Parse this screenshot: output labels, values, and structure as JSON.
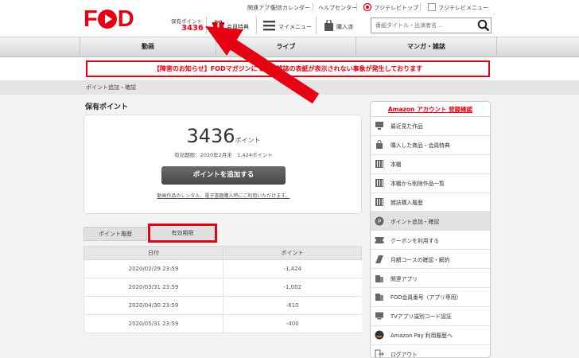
{
  "header": {
    "logo": "FOD",
    "top_links": [
      "関連アプリ",
      "配信カレンダー",
      "ヘルプセンター",
      "フジテレビトップ",
      "フジテレビメニュー"
    ],
    "points_label": "保有ポイント",
    "points_value": "3436",
    "member_benefits": "会員特典",
    "my_menu": "マイメニュー",
    "purchased": "購入済",
    "search_placeholder": "番組タイトル・出演者名..."
  },
  "nav": {
    "tabs": [
      "動画",
      "ライブ",
      "マンガ・雑誌"
    ]
  },
  "notice": "【障害のお知らせ】FODマガジンにて一部雑誌の表紙が表示されない事象が発生しております",
  "breadcrumb": "ポイント追加・確認",
  "points_section": {
    "title": "保有ポイント",
    "value": "3436",
    "unit": "ポイント",
    "expiry": "有効期限：2020年2月末　1,424ポイント",
    "add_button": "ポイントを追加する",
    "note": "動画作品のレンタル、電子書籍購入時にご利用いただけます。"
  },
  "tabs": {
    "history": "ポイント履歴",
    "expiry": "有効期限"
  },
  "table": {
    "headers": [
      "日付",
      "ポイント"
    ],
    "rows": [
      [
        "2020/02/29 23:59",
        "-1,424"
      ],
      [
        "2020/03/31 23:59",
        "-1,002"
      ],
      [
        "2020/04/30 23:59",
        "-610"
      ],
      [
        "2020/05/31 23:59",
        "-400"
      ]
    ]
  },
  "sidebar": {
    "header": "Amazon アカウント 登録確認",
    "items": [
      {
        "label": "最近見た作品",
        "icon": "monitor-icon"
      },
      {
        "label": "購入した商品・会員特典",
        "icon": "shopping-bag-icon"
      },
      {
        "label": "本棚",
        "icon": "bookshelf-icon"
      },
      {
        "label": "本棚から削除作品一覧",
        "icon": "bookshelf-icon"
      },
      {
        "label": "雑誌購入履歴",
        "icon": "bookshelf-icon"
      },
      {
        "label": "ポイント追加・確認",
        "icon": "points-icon"
      },
      {
        "label": "クーポンを利用する",
        "icon": "coupon-icon"
      },
      {
        "label": "月額コースの確認・解約",
        "icon": "calendar-icon"
      },
      {
        "label": "関連アプリ",
        "icon": "devices-icon"
      },
      {
        "label": "FOD会員番号（アプリ専用）",
        "icon": "devices-icon"
      },
      {
        "label": "TVアプリ識別コード認証",
        "icon": "tv-icon"
      },
      {
        "label": "Amazon Pay 利用履歴へ",
        "icon": "amazon-icon"
      },
      {
        "label": "ログアウト",
        "icon": "logout-icon"
      }
    ]
  },
  "colors": {
    "brand": "#e60012",
    "button_dark": "#555555",
    "annotation": "#e60012"
  }
}
